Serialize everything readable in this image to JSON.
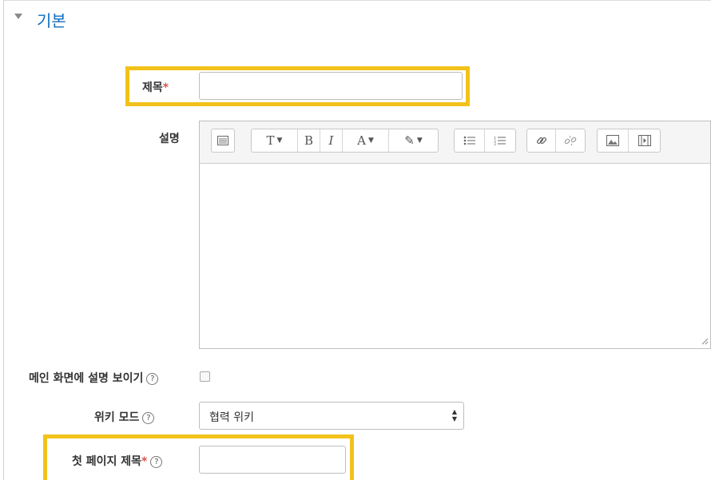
{
  "section": {
    "title": "기본",
    "toggle_icon": "triangle-down-icon"
  },
  "fields": {
    "title": {
      "label": "제목",
      "required_mark": "*",
      "value": ""
    },
    "description": {
      "label": "설명"
    },
    "show_description": {
      "label": "메인 화면에 설명 보이기",
      "help": "?",
      "checked": false
    },
    "wiki_mode": {
      "label": "위키 모드",
      "help": "?",
      "value": "협력 위키"
    },
    "first_page": {
      "label": "첫 페이지 제목",
      "required_mark": "*",
      "help": "?",
      "value": ""
    }
  },
  "toolbar": {
    "show_more": "⊞",
    "paragraph": "T",
    "bold": "B",
    "italic": "I",
    "text_color": "A",
    "background_color": "✎",
    "unordered_list": "☰",
    "ordered_list": "☰",
    "link": "🔗",
    "unlink": "⛓",
    "image": "▣",
    "media": "▤"
  },
  "highlight_color": "#f2c21b",
  "accent_color": "#0f6cbf",
  "required_color": "#d9534f"
}
